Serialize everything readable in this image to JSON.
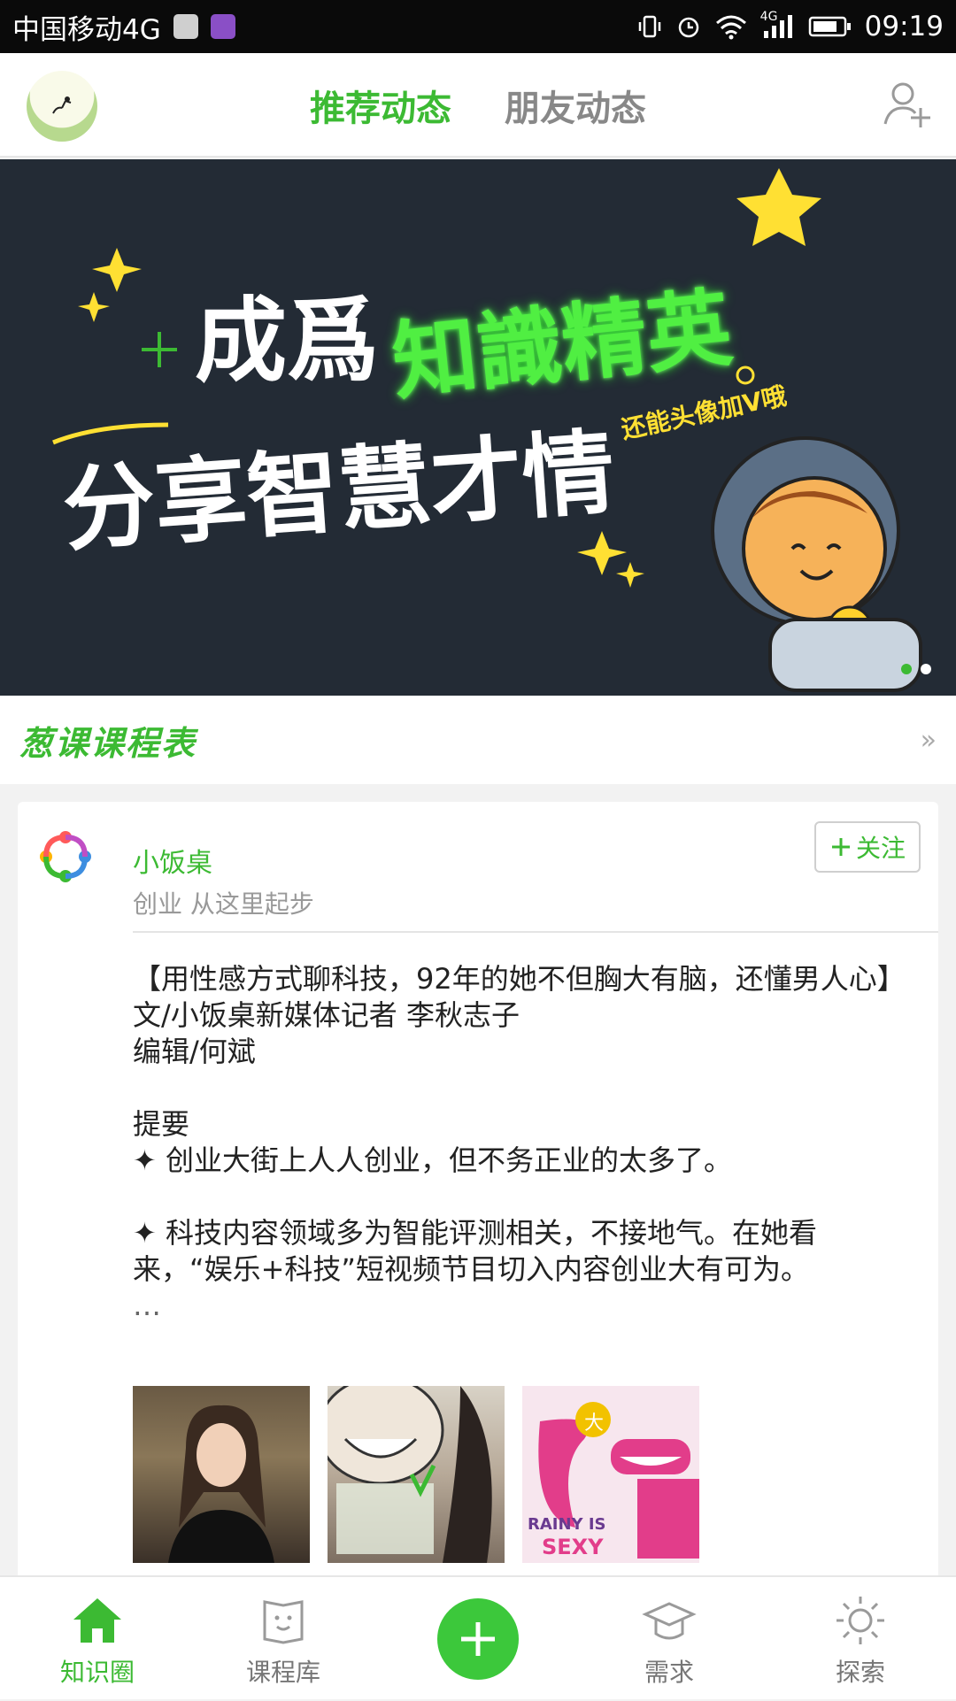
{
  "status_bar": {
    "carrier": "中国移动4G",
    "network": "4G",
    "time": "09:19"
  },
  "header": {
    "tabs": [
      {
        "label": "推荐动态",
        "active": true
      },
      {
        "label": "朋友动态",
        "active": false
      }
    ]
  },
  "banner": {
    "line1_white": "成爲",
    "line1_neon": "知識精英",
    "line2": "分享智慧才情",
    "subtitle": "还能头像加V哦",
    "slides": 2,
    "active_slide": 1
  },
  "schedule": {
    "title": "葱课课程表",
    "more": "»"
  },
  "post": {
    "author": "小饭桌",
    "bio": "创业 从这里起步",
    "follow_label": "关注",
    "lines": [
      "【用性感方式聊科技，92年的她不但胸大有脑，还懂男人心】",
      "文/小饭桌新媒体记者 李秋志子",
      "编辑/何斌",
      "",
      "提要",
      "✦ 创业大街上人人创业，但不务正业的太多了。",
      "",
      "✦ 科技内容领域多为智能评测相关，不接地气。在她看来，“娱乐+科技”短视频节目切入内容创业大有可为。"
    ],
    "ellipsis": "…",
    "thumb3_top": "大",
    "thumb3_bottom": "RAINY IS",
    "thumb3_sexy": "SEXY"
  },
  "bottom_nav": {
    "items": [
      {
        "label": "知识圈",
        "icon": "home-icon",
        "active": true
      },
      {
        "label": "课程库",
        "icon": "book-icon",
        "active": false
      },
      {
        "label": "需求",
        "icon": "graduation-cap-icon",
        "active": false
      },
      {
        "label": "探索",
        "icon": "sun-icon",
        "active": false
      }
    ]
  },
  "colors": {
    "accent": "#3cba33",
    "banner_bg": "#232b35",
    "neon": "#50ef42"
  }
}
